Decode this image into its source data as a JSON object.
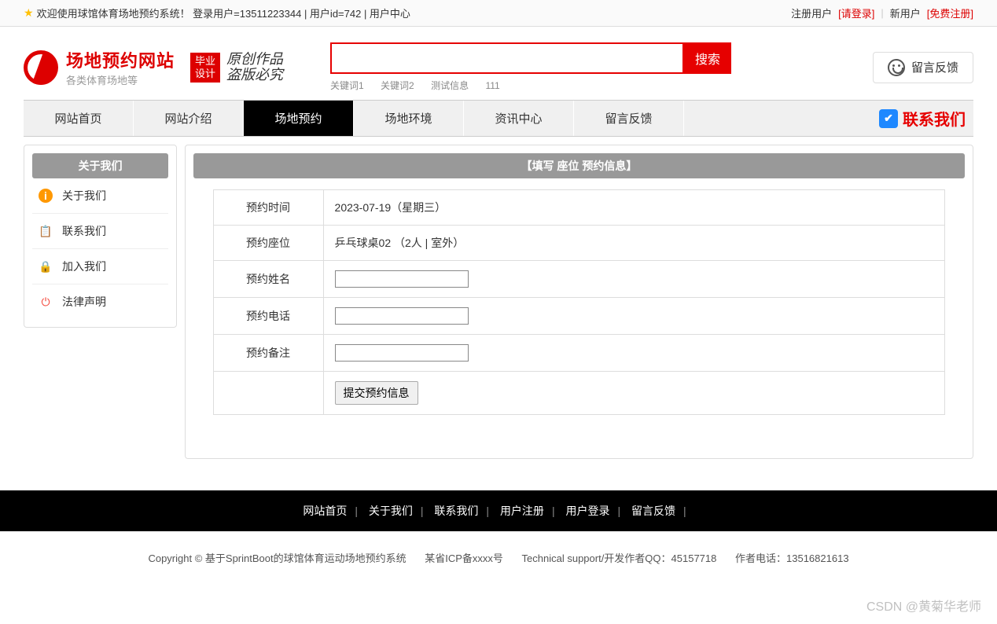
{
  "topbar": {
    "welcome": "欢迎使用球馆体育场地预约系统！ 登录用户=13511223344 | 用户id=742 | 用户中心",
    "registered_label": "注册用户",
    "login_link": "[请登录]",
    "new_user_label": "新用户",
    "register_link": "[免费注册]"
  },
  "logo": {
    "title": "场地预约网站",
    "sub": "各类体育场地等",
    "badge_line1": "毕业",
    "badge_line2": "设计",
    "slogan_line1": "原创作品",
    "slogan_line2": "盗版必究"
  },
  "search": {
    "value": "",
    "button": "搜索",
    "keywords": [
      "关键词1",
      "关键词2",
      "测试信息",
      "111"
    ]
  },
  "feedback_button": "留言反馈",
  "nav": {
    "items": [
      "网站首页",
      "网站介绍",
      "场地预约",
      "场地环境",
      "资讯中心",
      "留言反馈"
    ],
    "active_index": 2,
    "contact": "联系我们"
  },
  "sidebar": {
    "title": "关于我们",
    "items": [
      {
        "label": "关于我们",
        "icon": "info"
      },
      {
        "label": "联系我们",
        "icon": "clipboard"
      },
      {
        "label": "加入我们",
        "icon": "lock"
      },
      {
        "label": "法律声明",
        "icon": "power"
      }
    ]
  },
  "content": {
    "title": "【填写 座位 预约信息】",
    "rows": {
      "time_label": "预约时间",
      "time_value": "2023-07-19（星期三）",
      "seat_label": "预约座位",
      "seat_value": "乒乓球桌02 （2人 | 室外）",
      "name_label": "预约姓名",
      "phone_label": "预约电话",
      "remark_label": "预约备注",
      "submit": "提交预约信息"
    }
  },
  "footer_nav": [
    "网站首页",
    "关于我们",
    "联系我们",
    "用户注册",
    "用户登录",
    "留言反馈"
  ],
  "copyright": {
    "text": "Copyright © 基于SprintBoot的球馆体育运动场地预约系统",
    "icp": "某省ICP备xxxx号",
    "support": "Technical support/开发作者QQ：45157718",
    "phone": "作者电话：13516821613"
  },
  "watermark": "CSDN @黄菊华老师"
}
